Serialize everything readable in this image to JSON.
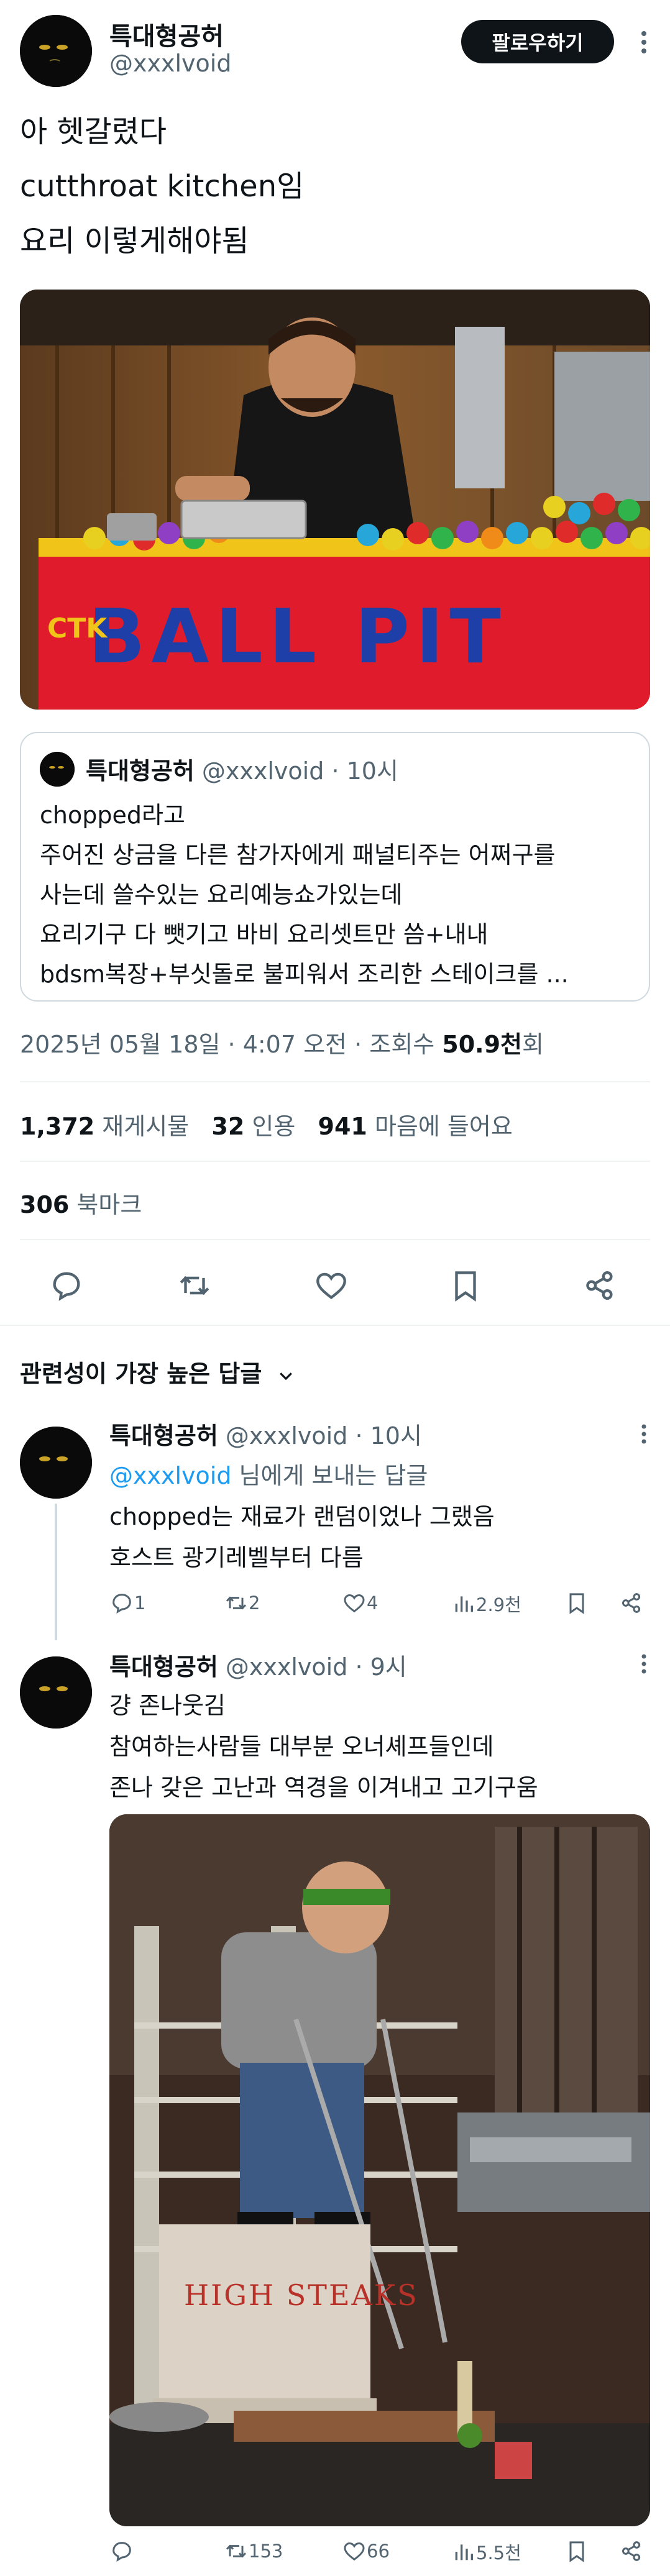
{
  "main_tweet": {
    "author_name": "특대형공허",
    "author_handle": "@xxxlvoid",
    "follow_label": "팔로우하기",
    "text_lines": [
      "아 헷갈렸다",
      "cutthroat kitchen임",
      "요리 이렇게해야됨"
    ],
    "media": {
      "alt": "ball pit cooking station photo",
      "sign_text": "BALL PIT",
      "side_text": "CTK"
    },
    "quoted": {
      "author_name": "특대형공허",
      "author_handle": "@xxxlvoid",
      "time": "· 10시",
      "lines": [
        "chopped라고",
        "주어진 상금을 다른 참가자에게 패널티주는 어쩌구를",
        "사는데 쓸수있는 요리예능쇼가있는데",
        "요리기구 다 뺏기고 바비 요리셋트만 씀+내내",
        "bdsm복장+부싯돌로 불피워서 조리한 스테이크를 ..."
      ]
    },
    "timestamp": "2025년 05월 18일 · 4:07 오전 ·",
    "views_label": "조회수",
    "views_value": "50.9천",
    "views_suffix": "회",
    "stats": {
      "retweets_num": "1,372",
      "retweets_label": "재게시물",
      "quotes_num": "32",
      "quotes_label": "인용",
      "likes_num": "941",
      "likes_label": "마음에 들어요",
      "bookmarks_num": "306",
      "bookmarks_label": "북마크"
    }
  },
  "replies_header": "관련성이 가장 높은 답글",
  "replies": [
    {
      "author_name": "특대형공허",
      "author_handle": "@xxxlvoid",
      "time": "· 10시",
      "reply_to_handle": "@xxxlvoid",
      "reply_to_suffix": "님에게 보내는 답글",
      "text_lines": [
        "chopped는 재료가 랜덤이었나 그랬음",
        "호스트 광기레벨부터 다름"
      ],
      "replies": "1",
      "retweets": "2",
      "likes": "4",
      "views": "2.9천"
    },
    {
      "author_name": "특대형공허",
      "author_handle": "@xxxlvoid",
      "time": "· 9시",
      "text_lines": [
        "걍 존나웃김",
        "참여하는사람들 대부분 오너셰프들인데",
        "존나 갖은 고난과 역경을 이겨내고 고기구움"
      ],
      "media": {
        "alt": "high steaks cooking photo",
        "sign_text": "HIGH STEAKS"
      },
      "replies": "",
      "retweets": "153",
      "likes": "66",
      "views": "5.5천"
    }
  ],
  "colors": {
    "text": "#0f1419",
    "muted": "#536471",
    "link": "#1d9bf0",
    "border": "#cfd9de",
    "divider": "#eff3f4"
  },
  "icons": [
    "reply-icon",
    "retweet-icon",
    "like-icon",
    "bookmark-icon",
    "share-icon",
    "views-icon",
    "more-icon",
    "chevron-down-icon"
  ]
}
